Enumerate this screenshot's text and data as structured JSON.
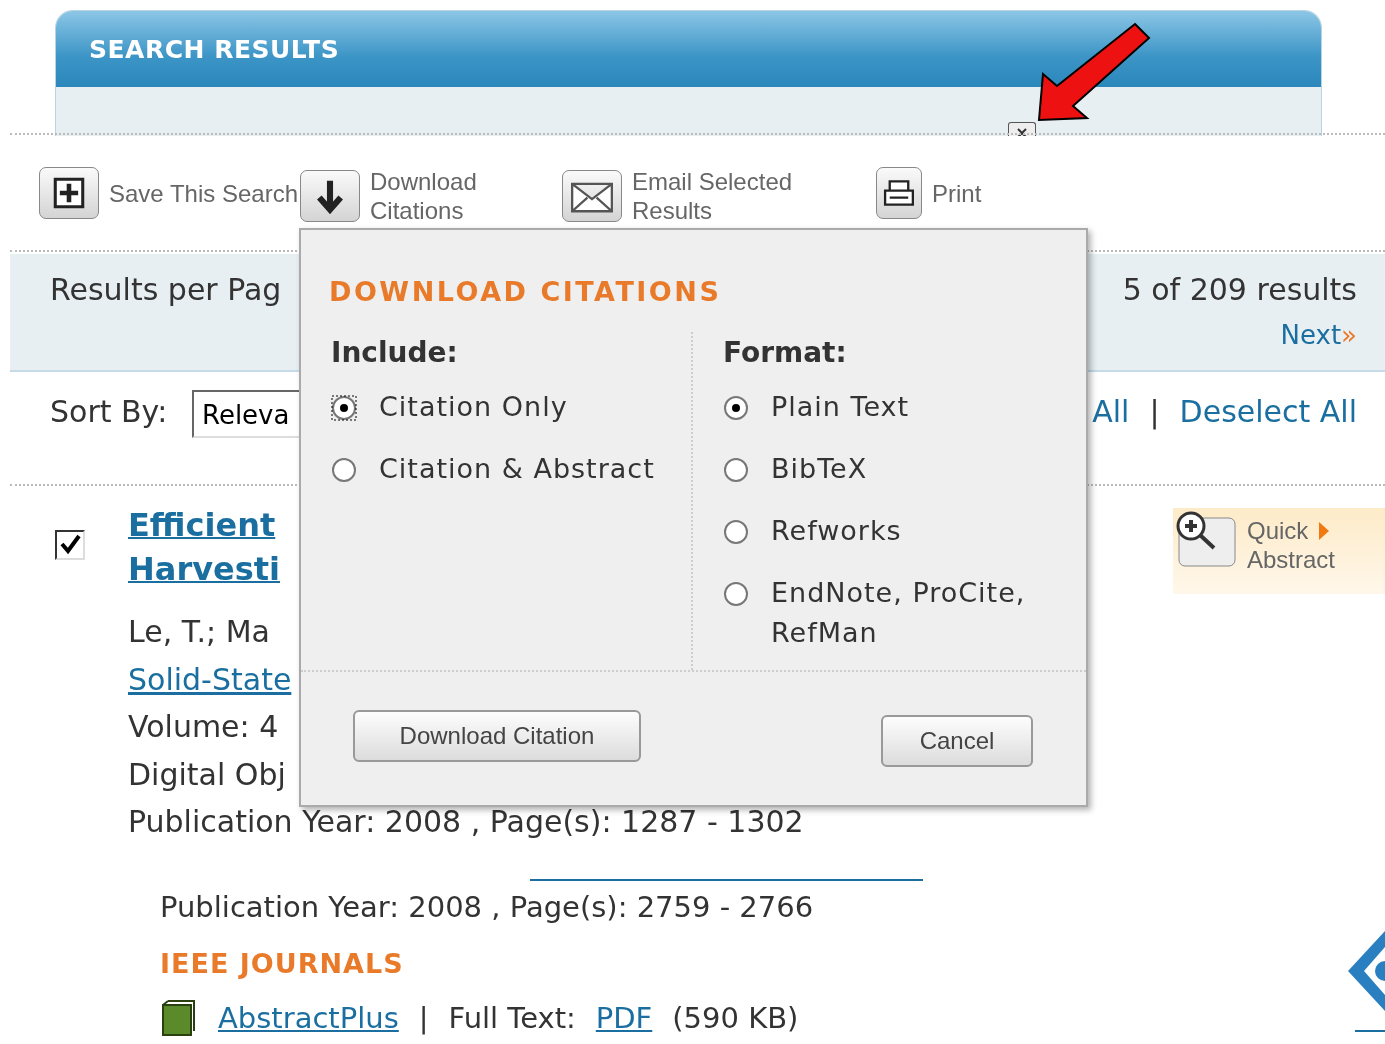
{
  "banner": {
    "title": "SEARCH RESULTS"
  },
  "toolbar": [
    {
      "kind": "save",
      "label": "Save This Search"
    },
    {
      "kind": "download",
      "label": "Download Citations"
    },
    {
      "kind": "email",
      "label": "Email Selected Results"
    },
    {
      "kind": "print",
      "label": "Print"
    }
  ],
  "results_bar": {
    "per_page_label": "Results per Pag",
    "count": "5 of 209 results",
    "next": "Next",
    "next_arrow": "»"
  },
  "sort": {
    "label": "Sort By:",
    "value": "Releva",
    "select_all": "All",
    "separator": "|",
    "deselect_all": "Deselect All"
  },
  "result": {
    "checked": true,
    "title_lines": [
      "Efficient",
      "Harvesti"
    ],
    "lines": [
      "Le, T.; Ma",
      "Solid-State",
      "Volume: 4",
      "Digital Obj",
      "Publication Year: 2008 , Page(s): 1287 - 1302"
    ],
    "quick_abstract": [
      "Quick",
      "Abstract"
    ]
  },
  "result_2": {
    "publication": "Publication Year: 2008 , Page(s): 2759 - 2766",
    "source": "IEEE JOURNALS",
    "abstract_link": "AbstractPlus",
    "separator": "|",
    "full_text_label": "Full Text:",
    "pdf_link": "PDF",
    "size": "(590 KB)"
  },
  "dialog": {
    "title": "DOWNLOAD CITATIONS",
    "include": {
      "label": "Include:",
      "options": [
        {
          "label": "Citation Only",
          "selected": true
        },
        {
          "label": "Citation & Abstract",
          "selected": false
        }
      ]
    },
    "format": {
      "label": "Format:",
      "options": [
        {
          "label": "Plain Text",
          "selected": true
        },
        {
          "label": "BibTeX",
          "selected": false
        },
        {
          "label": "Refworks",
          "selected": false
        },
        {
          "label": "EndNote, ProCite, RefMan",
          "selected": false
        }
      ]
    },
    "buttons": [
      {
        "kind": "download",
        "label": "Download Citation"
      },
      {
        "kind": "cancel",
        "label": "Cancel"
      }
    ]
  }
}
